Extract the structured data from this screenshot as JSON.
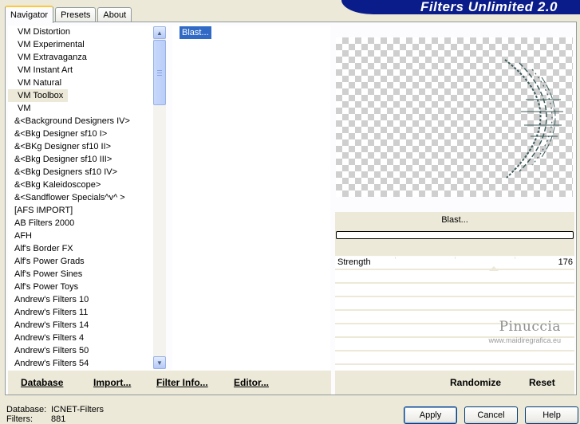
{
  "window": {
    "title": "Filters Unlimited 2.0"
  },
  "tabs": [
    {
      "label": "Navigator",
      "active": true
    },
    {
      "label": "Presets",
      "active": false
    },
    {
      "label": "About",
      "active": false
    }
  ],
  "categories": [
    "VM Distortion",
    "VM Experimental",
    "VM Extravaganza",
    "VM Instant Art",
    "VM Natural",
    "VM Toolbox",
    "VM",
    "&<Background Designers IV>",
    "&<Bkg Designer sf10 I>",
    "&<BKg Designer sf10 II>",
    "&<Bkg Designer sf10 III>",
    "&<Bkg Designers sf10 IV>",
    "&<Bkg Kaleidoscope>",
    "&<Sandflower Specials^v^ >",
    "[AFS IMPORT]",
    "AB Filters 2000",
    "AFH",
    "Alf's Border FX",
    "Alf's Power Grads",
    "Alf's Power Sines",
    "Alf's Power Toys",
    "Andrew's Filters 10",
    "Andrew's Filters 11",
    "Andrew's Filters 14",
    "Andrew's Filters 4",
    "Andrew's Filters 50",
    "Andrew's Filters 54"
  ],
  "selected_category": "VM Toolbox",
  "filters": [
    "Blast..."
  ],
  "preview": {
    "filter_name": "Blast...",
    "progress": 0
  },
  "parameters": [
    {
      "label": "Strength",
      "value": "176",
      "fraction": 0.69
    }
  ],
  "watermark": {
    "name": "Pinuccia",
    "url": "www.maidiregrafica.eu"
  },
  "bottom_left": {
    "database": "Database",
    "import": "Import...",
    "filter_info": "Filter Info...",
    "editor": "Editor..."
  },
  "bottom_right": {
    "randomize": "Randomize",
    "reset": "Reset"
  },
  "status": {
    "database_label": "Database:",
    "database_value": "ICNET-Filters",
    "filters_label": "Filters:",
    "filters_value": "881"
  },
  "buttons": {
    "apply": "Apply",
    "cancel": "Cancel",
    "help": "Help"
  },
  "colors": {
    "banner": "#0a1c8a",
    "selection": "#316ac5",
    "face": "#ece9d8"
  }
}
